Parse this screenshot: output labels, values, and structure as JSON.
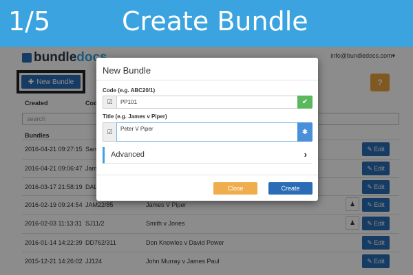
{
  "banner": {
    "step": "1/5",
    "title": "Create Bundle"
  },
  "app": {
    "logo_part1": "bundle",
    "logo_part2": "docs",
    "user_email": "info@bundledocs.com",
    "user_caret": "▾",
    "new_bundle_label": "New Bundle",
    "help_label": "?",
    "columns": {
      "created": "Created",
      "code": "Code"
    },
    "search_placeholder": "search",
    "section_label": "Bundles",
    "edit_label": "Edit",
    "rows": [
      {
        "created": "2016-04-21 09:27:15",
        "code": "San",
        "title": "",
        "shared": false
      },
      {
        "created": "2016-04-21 09:06:47",
        "code": "Jam",
        "title": "",
        "shared": false
      },
      {
        "created": "2016-03-17 21:58:19",
        "code": "DAL",
        "title": "",
        "shared": false
      },
      {
        "created": "2016-02-19 09:24:54",
        "code": "JAM22/85",
        "title": "James V Piper",
        "shared": true
      },
      {
        "created": "2016-02-03 11:13:31",
        "code": "SJ11/2",
        "title": "Smith v Jones",
        "shared": true
      },
      {
        "created": "2016-01-14 14:22:39",
        "code": "DD762/311",
        "title": "Don Knowles v David Power",
        "shared": false
      },
      {
        "created": "2015-12-21 14:26:02",
        "code": "JJ124",
        "title": "John Murray v James Paul",
        "shared": false
      }
    ]
  },
  "modal": {
    "title": "New Bundle",
    "code_label": "Code (e.g. ABC20/1)",
    "code_value": "PP101",
    "title_label": "Title (e.g. James v Piper)",
    "title_value": "Peter V Piper",
    "advanced_label": "Advanced",
    "close_label": "Close",
    "create_label": "Create"
  },
  "colors": {
    "banner": "#3aa3e0",
    "primary": "#2a6db5",
    "warning": "#f0ad4e",
    "success": "#5cb85c"
  }
}
